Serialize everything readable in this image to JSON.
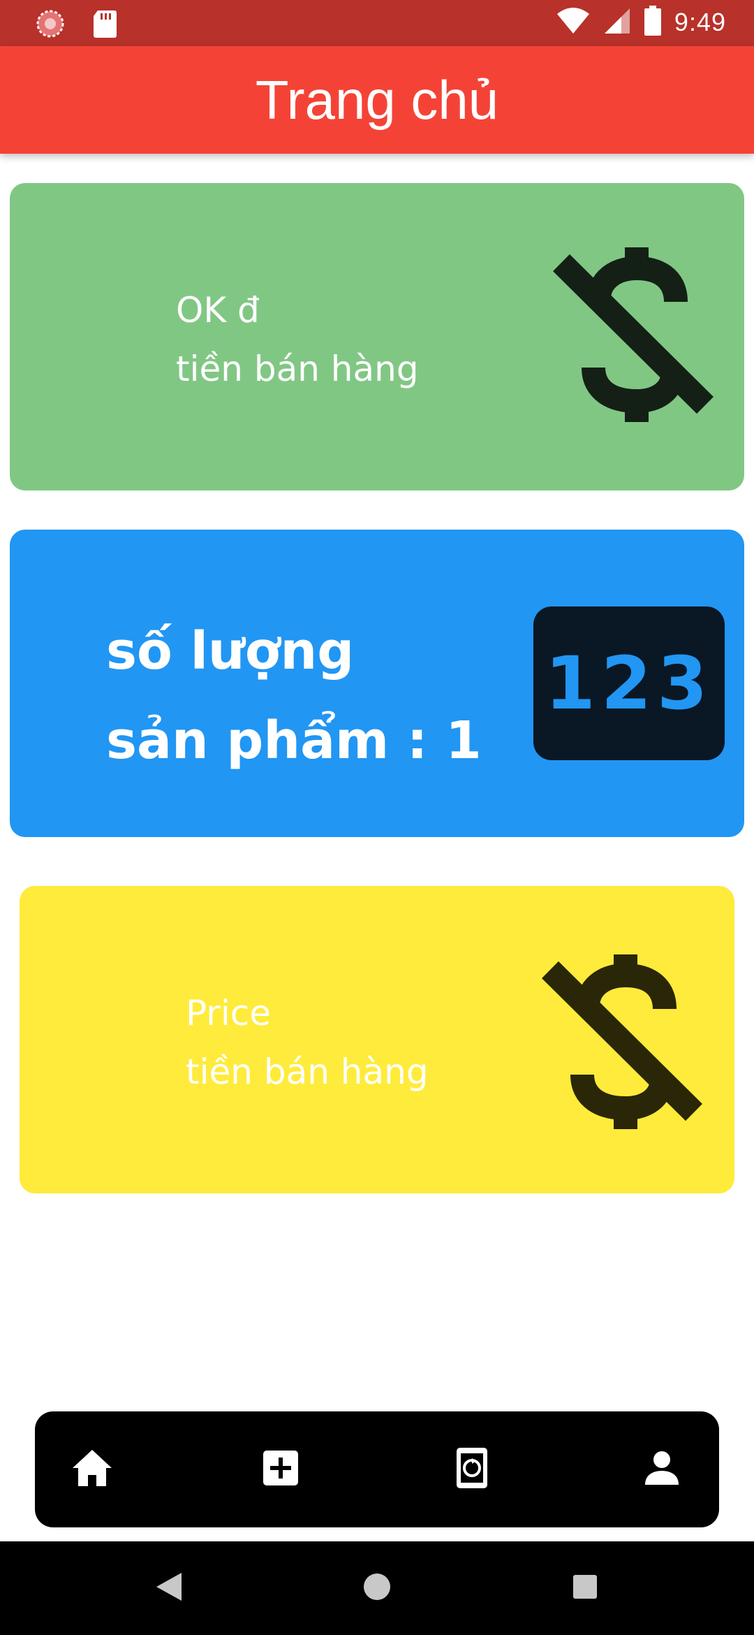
{
  "status_bar": {
    "time": "9:49",
    "icons": [
      "loading-icon",
      "sd-card-icon",
      "wifi-icon",
      "signal-icon",
      "battery-icon"
    ]
  },
  "app_bar": {
    "title": "Trang chủ"
  },
  "cards": {
    "sales": {
      "line1": "OK đ",
      "line2": "tiền bán hàng",
      "icon": "money-off-icon",
      "color": "#81c784"
    },
    "quantity": {
      "line1": "số lượng",
      "line2": "sản phẩm : 1",
      "badge": "123",
      "icon": "numbers-icon",
      "color": "#2196f3"
    },
    "price": {
      "line1": "Price",
      "line2": "tiền bán hàng",
      "icon": "money-off-icon",
      "color": "#ffeb3b"
    }
  },
  "bottom_nav": {
    "items": [
      {
        "icon": "home-icon"
      },
      {
        "icon": "add-box-icon"
      },
      {
        "icon": "screen-rotation-icon"
      },
      {
        "icon": "person-icon"
      }
    ]
  },
  "system_nav": {
    "buttons": [
      "back-icon",
      "home-circle-icon",
      "recents-icon"
    ]
  },
  "colors": {
    "status_bar": "#b8312a",
    "app_bar": "#f44336",
    "nav_bg": "#000000"
  }
}
